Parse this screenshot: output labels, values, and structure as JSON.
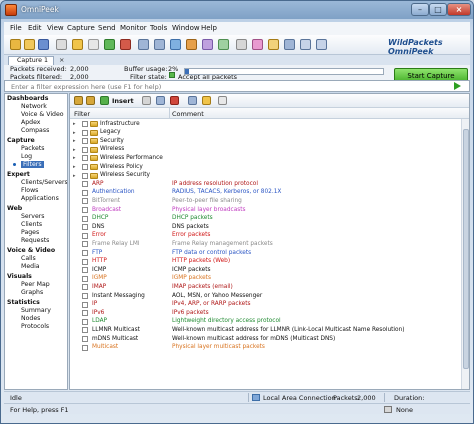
{
  "window": {
    "title": "OmniPeek"
  },
  "menu": [
    "File",
    "Edit",
    "View",
    "Capture",
    "Send",
    "Monitor",
    "Tools",
    "Window",
    "Help"
  ],
  "brand": {
    "text": "WildPackets OmniPeek"
  },
  "tab": {
    "label": "Capture 1",
    "close": "×"
  },
  "stats": {
    "received_label": "Packets received:",
    "received_value": "2,000",
    "filtered_label": "Packets filtered:",
    "filtered_value": "2,000",
    "buffer_label": "Buffer usage:",
    "buffer_value": "2%",
    "filter_state_label": "Filter state:",
    "filter_state_value": "Accept all packets",
    "start_button": "Start Capture"
  },
  "filterbar": {
    "placeholder": "Enter a filter expression here (use F1 for help)"
  },
  "nav": [
    {
      "label": "Dashboards",
      "kind": "h"
    },
    {
      "label": "Network",
      "kind": "s"
    },
    {
      "label": "Voice & Video",
      "kind": "s"
    },
    {
      "label": "Apdex",
      "kind": "s"
    },
    {
      "label": "Compass",
      "kind": "s"
    },
    {
      "label": "Capture",
      "kind": "h"
    },
    {
      "label": "Packets",
      "kind": "s"
    },
    {
      "label": "Log",
      "kind": "s"
    },
    {
      "label": "Filters",
      "kind": "sel"
    },
    {
      "label": "Expert",
      "kind": "h"
    },
    {
      "label": "Clients/Servers",
      "kind": "s"
    },
    {
      "label": "Flows",
      "kind": "s"
    },
    {
      "label": "Applications",
      "kind": "s"
    },
    {
      "label": "Web",
      "kind": "h"
    },
    {
      "label": "Servers",
      "kind": "s"
    },
    {
      "label": "Clients",
      "kind": "s"
    },
    {
      "label": "Pages",
      "kind": "s"
    },
    {
      "label": "Requests",
      "kind": "s"
    },
    {
      "label": "Voice & Video",
      "kind": "h"
    },
    {
      "label": "Calls",
      "kind": "s"
    },
    {
      "label": "Media",
      "kind": "s"
    },
    {
      "label": "Visuals",
      "kind": "h"
    },
    {
      "label": "Peer Map",
      "kind": "s"
    },
    {
      "label": "Graphs",
      "kind": "s"
    },
    {
      "label": "Statistics",
      "kind": "h"
    },
    {
      "label": "Summary",
      "kind": "s"
    },
    {
      "label": "Nodes",
      "kind": "s"
    },
    {
      "label": "Protocols",
      "kind": "s"
    }
  ],
  "content_toolbar": {
    "insert_label": "Insert"
  },
  "columns": {
    "filter": "Filter",
    "comment": "Comment"
  },
  "rows": [
    {
      "name": "Infrastructure",
      "comment": "",
      "folder": true,
      "color": "#111111"
    },
    {
      "name": "Legacy",
      "comment": "",
      "folder": true,
      "color": "#111111"
    },
    {
      "name": "Security",
      "comment": "",
      "folder": true,
      "color": "#111111"
    },
    {
      "name": "Wireless",
      "comment": "",
      "folder": true,
      "color": "#111111"
    },
    {
      "name": "Wireless Performance",
      "comment": "",
      "folder": true,
      "color": "#111111"
    },
    {
      "name": "Wireless Policy",
      "comment": "",
      "folder": true,
      "color": "#111111"
    },
    {
      "name": "Wireless Security",
      "comment": "",
      "folder": true,
      "color": "#111111"
    },
    {
      "name": "ARP",
      "comment": "IP address resolution protocol",
      "folder": false,
      "color": "#b01818"
    },
    {
      "name": "Authentication",
      "comment": "RADIUS, TACACS, Kerberos, or 802.1X",
      "folder": false,
      "color": "#2a55c4"
    },
    {
      "name": "BitTorrent",
      "comment": "Peer-to-peer file sharing",
      "folder": false,
      "color": "#8a8a8a"
    },
    {
      "name": "Broadcast",
      "comment": "Physical layer broadcasts",
      "folder": false,
      "color": "#c03cc0"
    },
    {
      "name": "DHCP",
      "comment": "DHCP packets",
      "folder": false,
      "color": "#1f8a30"
    },
    {
      "name": "DNS",
      "comment": "DNS packets",
      "folder": false,
      "color": "#111111"
    },
    {
      "name": "Error",
      "comment": "Error packets",
      "folder": false,
      "color": "#d01515"
    },
    {
      "name": "Frame Relay LMI",
      "comment": "Frame Relay management packets",
      "folder": false,
      "color": "#8a8a8a"
    },
    {
      "name": "FTP",
      "comment": "FTP data or control packets",
      "folder": false,
      "color": "#2a55c4"
    },
    {
      "name": "HTTP",
      "comment": "HTTP packets (Web)",
      "folder": false,
      "color": "#d01515"
    },
    {
      "name": "ICMP",
      "comment": "ICMP packets",
      "folder": false,
      "color": "#111111"
    },
    {
      "name": "IGMP",
      "comment": "IGMP packets",
      "folder": false,
      "color": "#d8731f"
    },
    {
      "name": "IMAP",
      "comment": "IMAP packets (email)",
      "folder": false,
      "color": "#b01818"
    },
    {
      "name": "Instant Messaging",
      "comment": "AOL, MSN, or Yahoo Messenger",
      "folder": false,
      "color": "#111111"
    },
    {
      "name": "IP",
      "comment": "IPv4, ARP, or RARP packets",
      "folder": false,
      "color": "#b01818"
    },
    {
      "name": "IPv6",
      "comment": "IPv6 packets",
      "folder": false,
      "color": "#b01818"
    },
    {
      "name": "LDAP",
      "comment": "Lightweight directory access protocol",
      "folder": false,
      "color": "#1f8a30"
    },
    {
      "name": "LLMNR Multicast",
      "comment": "Well-known multicast address for LLMNR (Link-Local Multicast Name Resolution)",
      "folder": false,
      "color": "#111111"
    },
    {
      "name": "mDNS Multicast",
      "comment": "Well-known multicast address for mDNS (Multicast DNS)",
      "folder": false,
      "color": "#111111"
    },
    {
      "name": "Multicast",
      "comment": "Physical layer multicast packets",
      "folder": false,
      "color": "#d8731f"
    }
  ],
  "status": {
    "left": "Idle",
    "connection": "Local Area Connection",
    "packets_label": "Packets:",
    "packets_value": "2,000",
    "duration_label": "Duration:",
    "help": "For Help, press F1",
    "none": "None"
  },
  "colors": {
    "accent": "#3b6fb8",
    "start_button": "#3aa81e"
  }
}
